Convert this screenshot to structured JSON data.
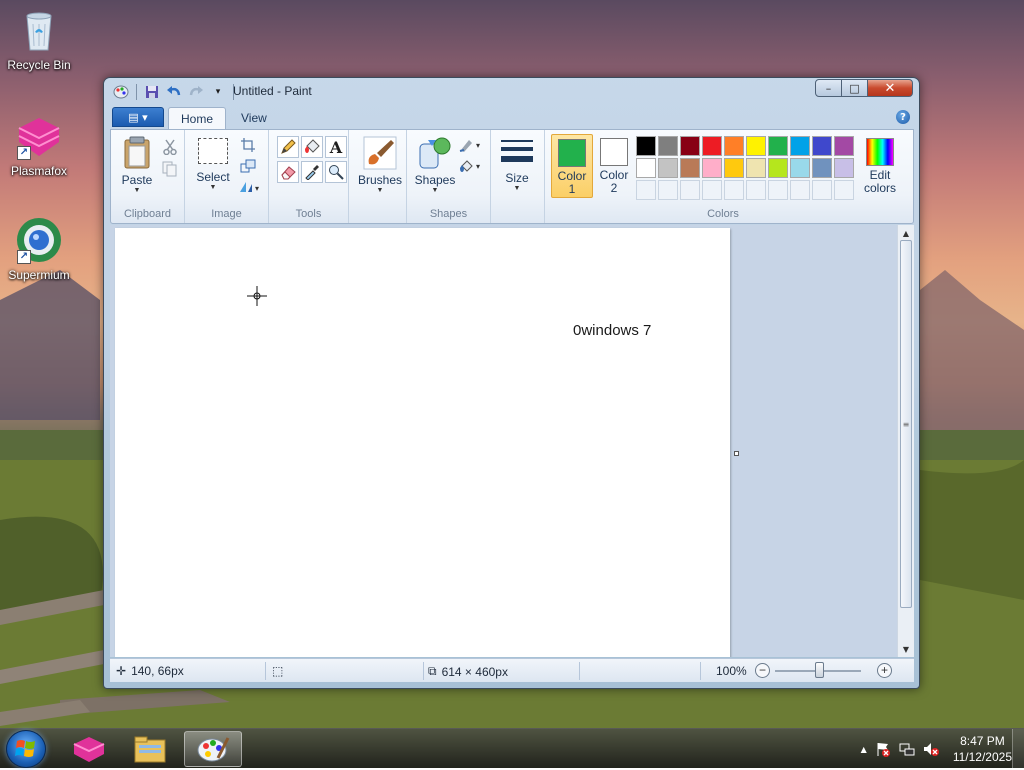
{
  "desktop": {
    "icons": [
      {
        "label": "Recycle Bin",
        "icon": "recycle-bin-icon"
      },
      {
        "label": "Plasmafox",
        "icon": "plasmafox-icon"
      },
      {
        "label": "Supermium",
        "icon": "supermium-icon"
      }
    ]
  },
  "window": {
    "title": "Untitled - Paint",
    "buttons": {
      "minimize": "–",
      "maximize": "□",
      "close": "✕"
    }
  },
  "ribbon": {
    "file_menu_glyph": "▤ ▾",
    "tabs": [
      {
        "label": "Home",
        "active": true
      },
      {
        "label": "View",
        "active": false
      }
    ],
    "help": "?",
    "groups": {
      "clipboard": {
        "label": "Clipboard",
        "paste": "Paste"
      },
      "image": {
        "label": "Image",
        "select": "Select"
      },
      "tools": {
        "label": "Tools"
      },
      "brushes": {
        "label": "Brushes"
      },
      "shapes": {
        "label": "Shapes",
        "shapes_btn": "Shapes"
      },
      "size": {
        "label": "Size"
      },
      "colors": {
        "label": "Colors",
        "color1_line1": "Color",
        "color1_line2": "1",
        "color2_line1": "Color",
        "color2_line2": "2",
        "edit_line1": "Edit",
        "edit_line2": "colors",
        "color1_value": "#22b14c",
        "color2_value": "#ffffff",
        "palette_row1": [
          "#000000",
          "#7f7f7f",
          "#880015",
          "#ed1c24",
          "#ff7f27",
          "#fff200",
          "#22b14c",
          "#00a2e8",
          "#3f48cc",
          "#a349a4"
        ],
        "palette_row2": [
          "#ffffff",
          "#c3c3c3",
          "#b97a57",
          "#ffaec9",
          "#ffc90e",
          "#efe4b0",
          "#b5e61d",
          "#99d9ea",
          "#7092be",
          "#c8bfe7"
        ]
      }
    }
  },
  "canvas": {
    "text": "0windows 7"
  },
  "statusbar": {
    "cursor_pos": "140, 66px",
    "canvas_size": "614 × 460px",
    "zoom": "100%",
    "zoom_out": "−",
    "zoom_in": "+"
  },
  "taskbar": {
    "apps": [
      {
        "name": "plasmafox-taskbar-icon",
        "active": false
      },
      {
        "name": "file-explorer-icon",
        "active": false
      },
      {
        "name": "paint-icon",
        "active": true
      }
    ],
    "tray_expand": "▲",
    "time": "8:47 PM",
    "date": "11/12/2025"
  }
}
